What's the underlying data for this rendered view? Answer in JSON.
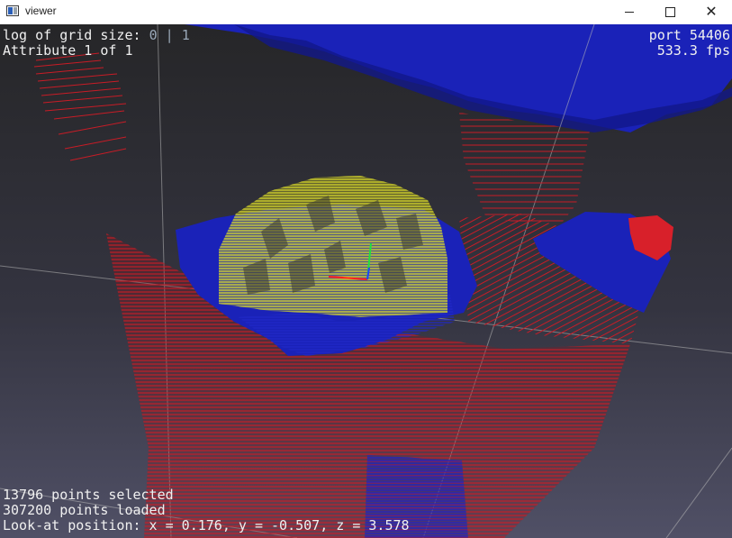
{
  "window": {
    "title": "viewer",
    "controls": {
      "minimize": "minimize",
      "maximize": "maximize",
      "close": "close"
    }
  },
  "hud": {
    "grid_label": "log of grid size: ",
    "grid_value_1": "0",
    "grid_sep": " | ",
    "grid_value_2": "1",
    "attribute": "Attribute 1 of 1",
    "port": "port 54406",
    "fps": "533.3 fps",
    "selected": "13796 points selected",
    "loaded": "307200 points loaded",
    "look_at": "Look-at position: x = 0.176, y = -0.507, z = 3.578"
  },
  "colors": {
    "background_top": "#2a2a2c",
    "background_bottom": "#4e4e62",
    "points_red": "#d8202a",
    "points_blue": "#1a22b8",
    "points_yellow": "#e8e830",
    "axis_x": "#ff2020",
    "axis_y": "#20e040",
    "axis_z": "#2040ff",
    "grid_lines": "#b8b8b8"
  },
  "icons": [
    "app-window-icon",
    "minimize-icon",
    "maximize-icon",
    "close-icon"
  ]
}
